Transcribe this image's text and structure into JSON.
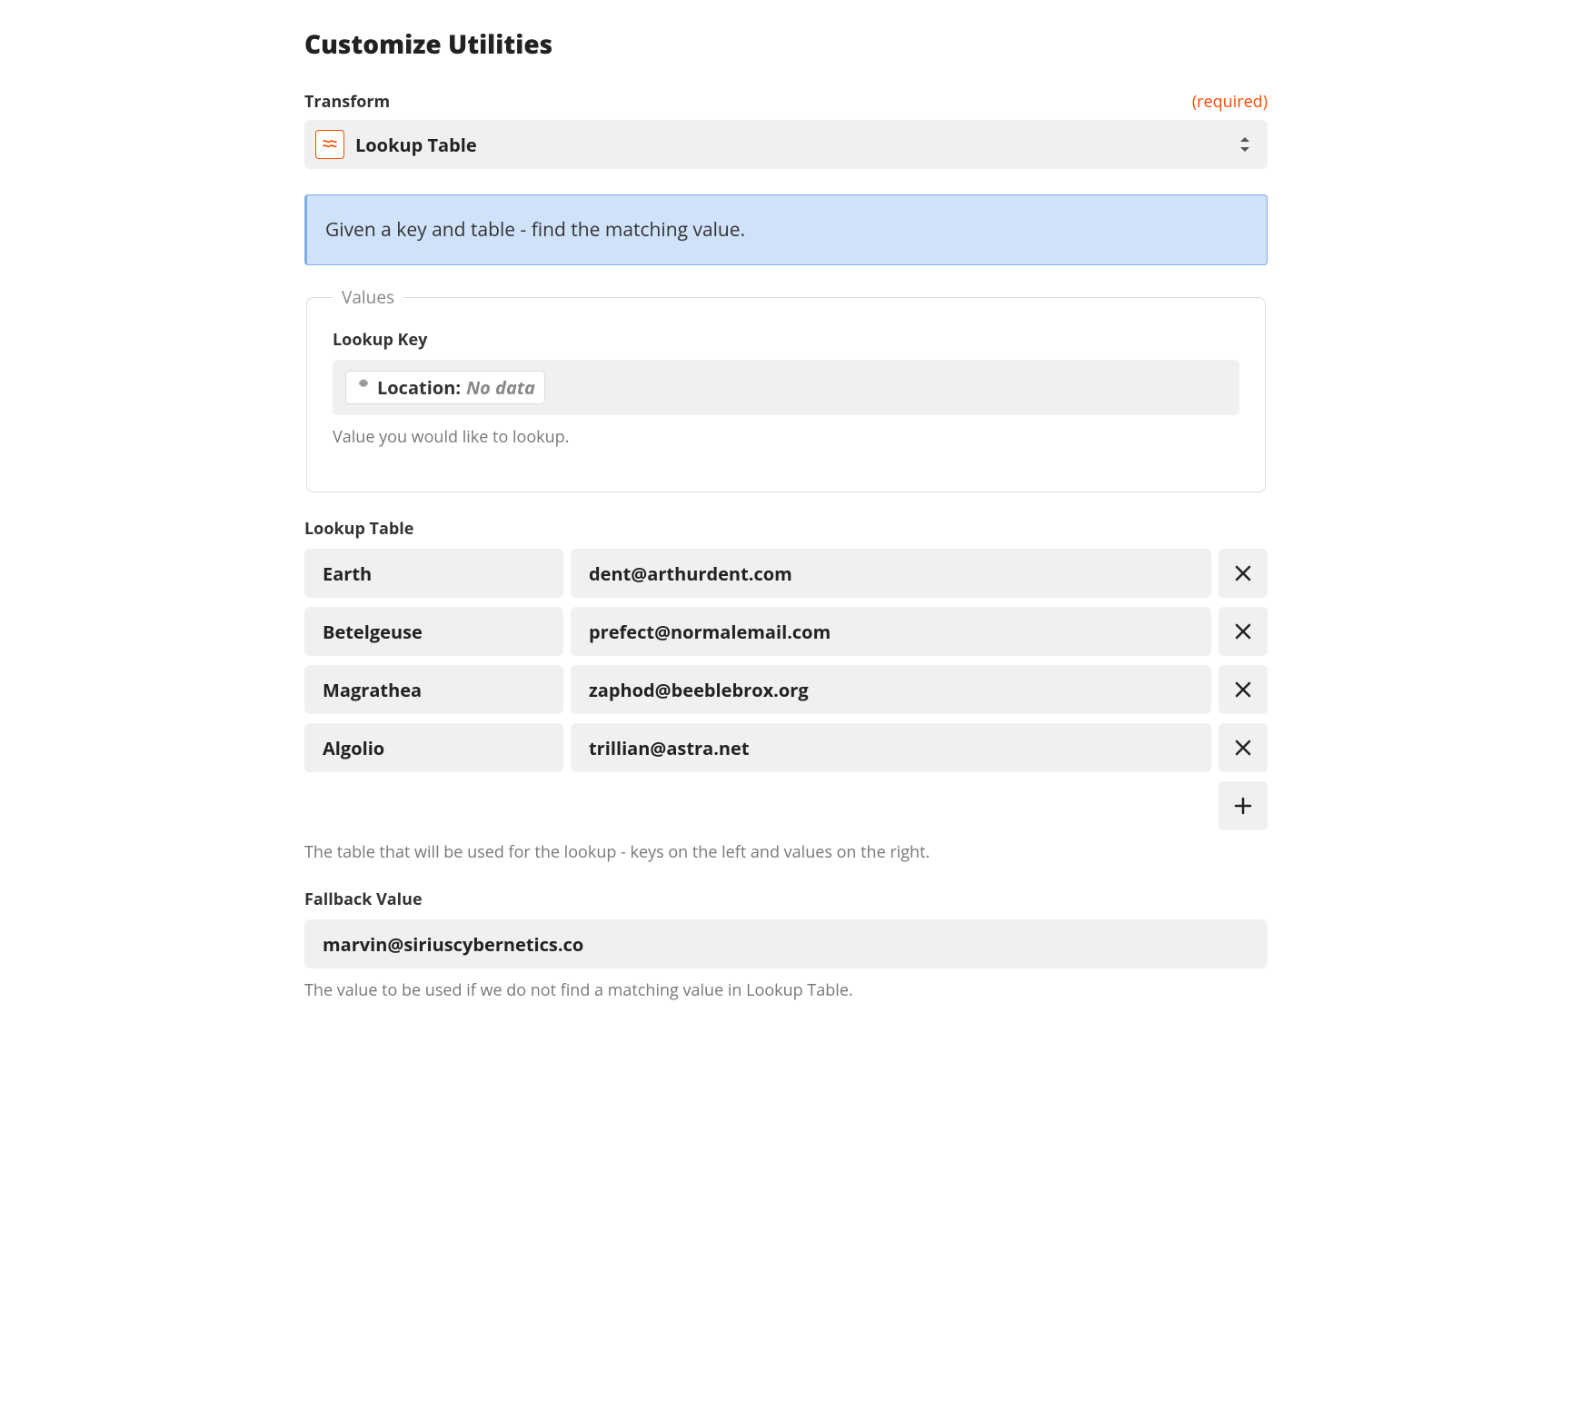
{
  "title": "Customize Utilities",
  "transform": {
    "label": "Transform",
    "required_text": "(required)",
    "selected": "Lookup Table"
  },
  "banner": "Given a key and table - find the matching value.",
  "values": {
    "legend": "Values",
    "lookup_key_label": "Lookup Key",
    "key_field": "Location:",
    "key_value": "No data",
    "help": "Value you would like to lookup."
  },
  "lookup_table": {
    "label": "Lookup Table",
    "rows": [
      {
        "key": "Earth",
        "value": "dent@arthurdent.com"
      },
      {
        "key": "Betelgeuse",
        "value": "prefect@normalemail.com"
      },
      {
        "key": "Magrathea",
        "value": "zaphod@beeblebrox.org"
      },
      {
        "key": "Algolio",
        "value": "trillian@astra.net"
      }
    ],
    "help": "The table that will be used for the lookup - keys on the left and values on the right."
  },
  "fallback": {
    "label": "Fallback Value",
    "value": "marvin@siriuscybernetics.co",
    "help": "The value to be used if we do not find a matching value in Lookup Table."
  }
}
